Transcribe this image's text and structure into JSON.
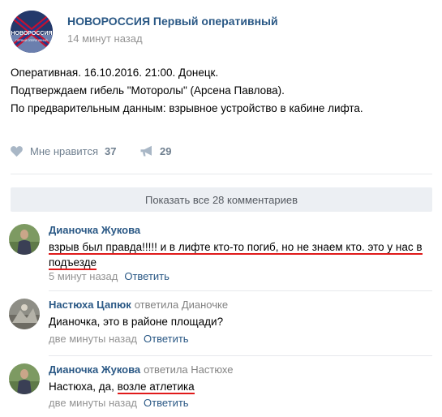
{
  "post": {
    "group_name": "НОВОРОССИЯ Первый оперативный",
    "avatar_text": "НОВОРОССИЯ",
    "avatar_subtext": "ПЕРВЫЙ ОПЕРАТИВНЫЙ",
    "time": "14 минут назад",
    "text_lines": [
      "Оперативная. 16.10.2016. 21:00. Донецк.",
      "Подтверждаем гибель \"Моторолы\" (Арсена Павлова).",
      "По предварительным данным: взрывное устройство в кабине лифта."
    ],
    "like_label": "Мне нравится",
    "like_icon": "heart-icon",
    "likes": "37",
    "share_icon": "megaphone-icon",
    "shares": "29"
  },
  "show_all_comments": "Показать все 28 комментариев",
  "comments": [
    {
      "author": "Дианочка Жукова",
      "reply_to": "",
      "text_plain": "взрыв был правда!!!!! и в лифте кто-то погиб, но не знаем кто. это у нас в",
      "text_highlight": "подъезде",
      "time": "5 минут назад",
      "reply_label": "Ответить"
    },
    {
      "author": "Настюха Цапюк",
      "reply_to": "ответила Дианочке",
      "text": "Дианочка, это в районе площади?",
      "time": "две минуты назад",
      "reply_label": "Ответить"
    },
    {
      "author": "Дианочка Жукова",
      "reply_to": "ответила Настюхе",
      "text_plain": "Настюха, да, ",
      "text_highlight": "возле атлетика",
      "time": "две минуты назад",
      "reply_label": "Ответить"
    }
  ],
  "colors": {
    "link": "#2a5885",
    "muted": "#939393",
    "highlight_underline": "#e01a1a",
    "show_all_bg": "#eceff3"
  }
}
